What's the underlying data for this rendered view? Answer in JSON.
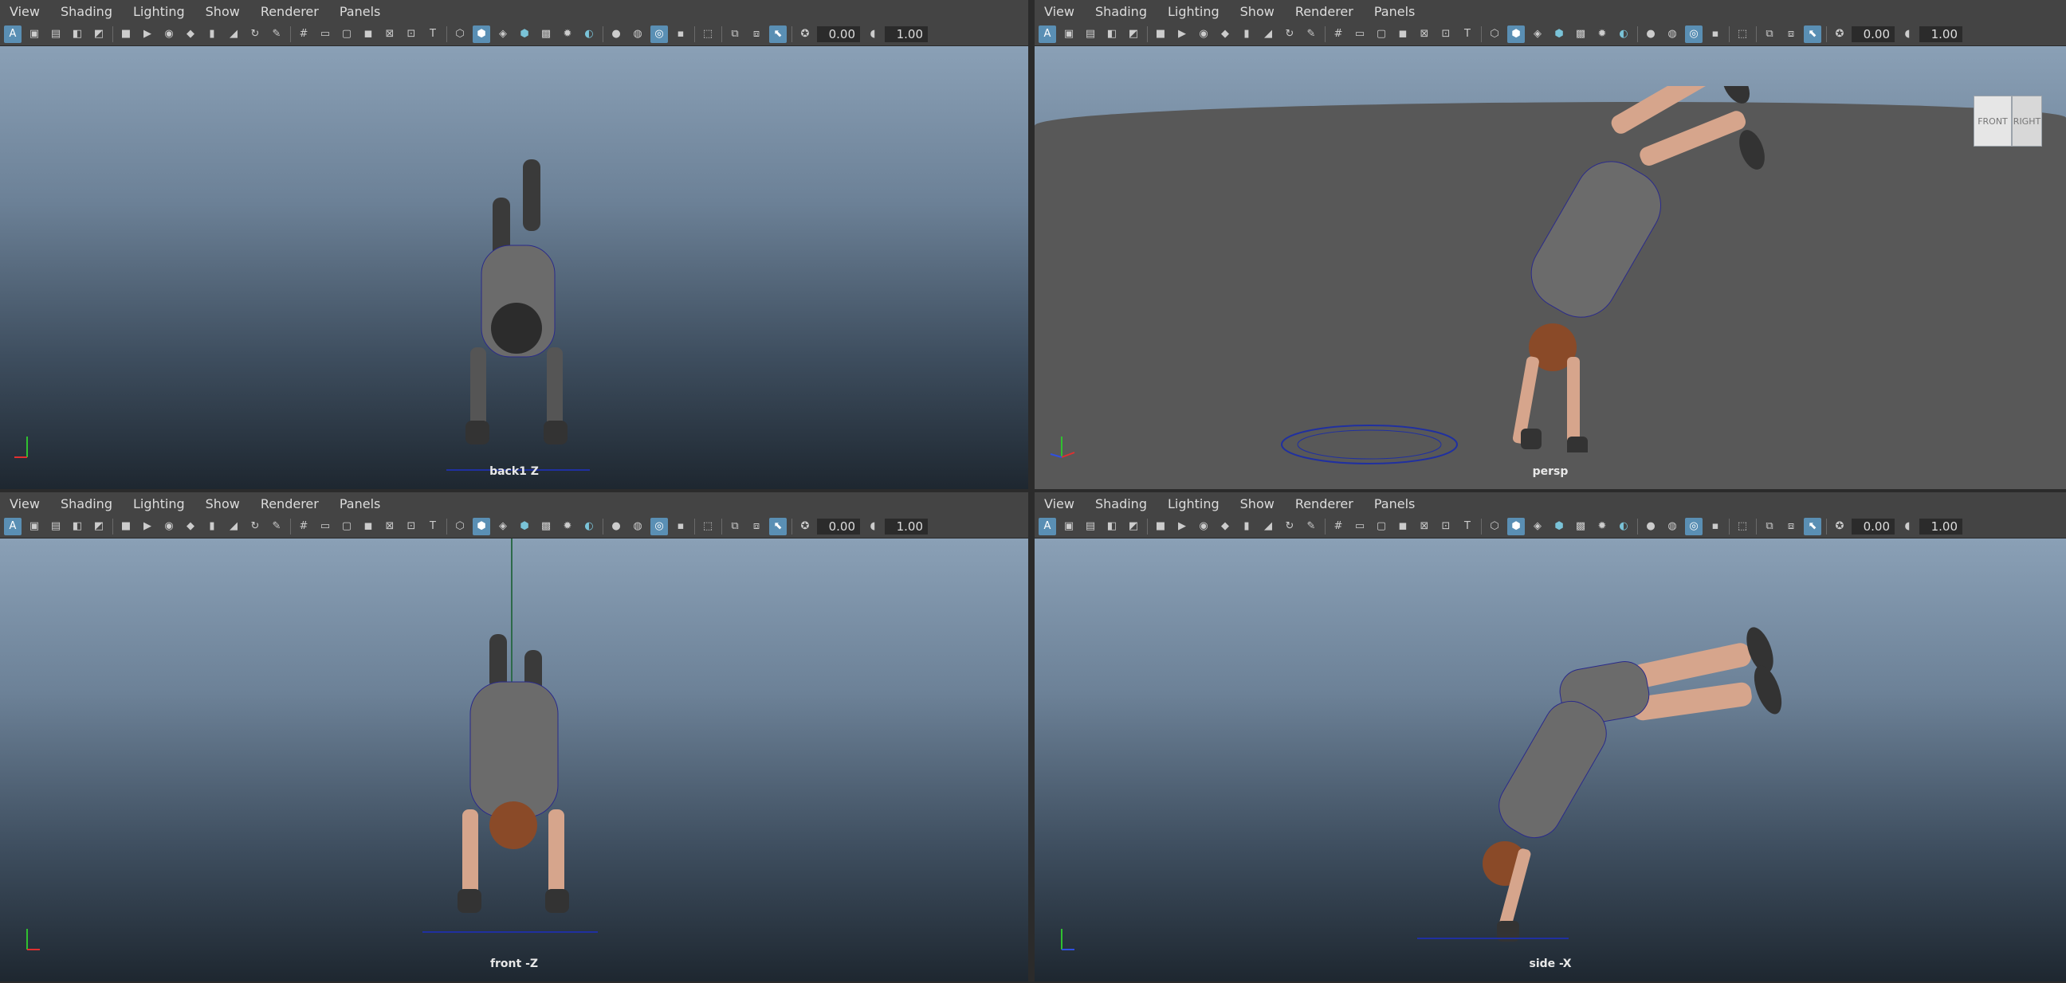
{
  "menus": [
    "View",
    "Shading",
    "Lighting",
    "Show",
    "Renderer",
    "Panels"
  ],
  "toolbar": {
    "value_a": "0.00",
    "value_b": "1.00"
  },
  "panels": [
    {
      "camera": "back1 Z",
      "axis_h": "x",
      "axis_v": "y"
    },
    {
      "camera": "persp",
      "axis_h": "x",
      "axis_v": "y",
      "axis_d": "z"
    },
    {
      "camera": "front -Z",
      "axis_h": "x",
      "axis_v": "y"
    },
    {
      "camera": "side -X",
      "axis_h": "z",
      "axis_v": "y"
    }
  ],
  "viewcube": {
    "front": "FRONT",
    "right": "RIGHT"
  },
  "colors": {
    "accent": "#5a8fb4",
    "panel_bg": "#444444",
    "sky_top": "#8aa0b6",
    "sky_bottom": "#1e2730",
    "axis_x": "#e03030",
    "axis_y": "#30c030",
    "axis_z": "#3050e0"
  },
  "icons": [
    "select-icon",
    "camera-icon",
    "grid-icon",
    "shaded-cube-icon",
    "light-icon",
    "isolate-icon",
    "exposure-icon",
    "gamma-icon"
  ]
}
